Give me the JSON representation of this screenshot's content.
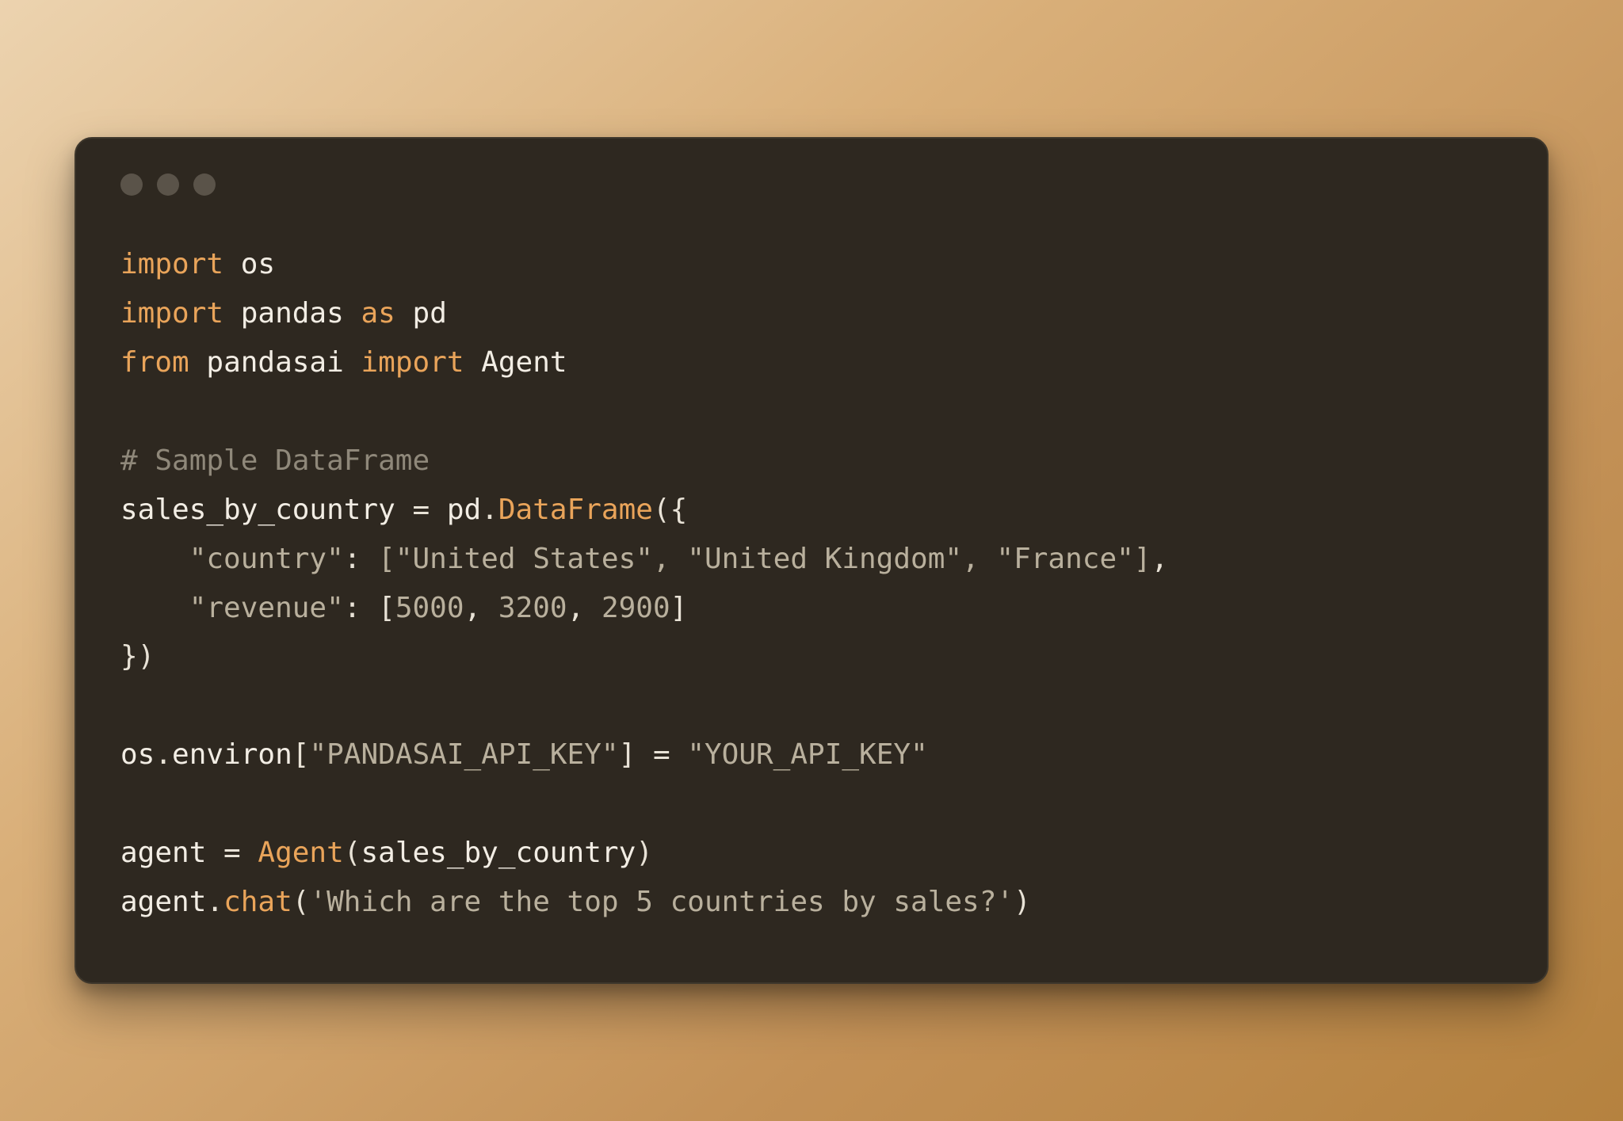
{
  "colors": {
    "bg_window": "#2e2820",
    "keyword": "#e9a45a",
    "identifier": "#f2ede4",
    "comment": "#8f887a",
    "string": "#b9b09d",
    "number": "#b9b09d",
    "func": "#e9a45a"
  },
  "code": {
    "l1": {
      "kw1": "import",
      "id1": "os"
    },
    "l2": {
      "kw1": "import",
      "id1": "pandas",
      "kw2": "as",
      "id2": "pd"
    },
    "l3": {
      "kw1": "from",
      "id1": "pandasai",
      "kw2": "import",
      "id2": "Agent"
    },
    "l4": "",
    "l5": {
      "cmt": "# Sample DataFrame"
    },
    "l6": {
      "id1": "sales_by_country",
      "op1": " = ",
      "id2": "pd",
      "dot": ".",
      "func1": "DataFrame",
      "open": "({"
    },
    "l7": {
      "indent": "    ",
      "key": "\"country\"",
      "colon": ": ",
      "val": "[\"United States\", \"United Kingdom\", \"France\"]",
      "comma": ","
    },
    "l8": {
      "indent": "    ",
      "key": "\"revenue\"",
      "colon": ": ",
      "open": "[",
      "n1": "5000",
      "c1": ", ",
      "n2": "3200",
      "c2": ", ",
      "n3": "2900",
      "close": "]"
    },
    "l9": {
      "close": "})"
    },
    "l10": "",
    "l11": {
      "id1": "os",
      "dot": ".",
      "id2": "environ",
      "open": "[",
      "key": "\"PANDASAI_API_KEY\"",
      "close": "]",
      "op1": " = ",
      "val": "\"YOUR_API_KEY\""
    },
    "l12": "",
    "l13": {
      "id1": "agent",
      "op1": " = ",
      "func1": "Agent",
      "open": "(",
      "arg": "sales_by_country",
      "close": ")"
    },
    "l14": {
      "id1": "agent",
      "dot": ".",
      "func1": "chat",
      "open": "(",
      "str": "'Which are the top 5 countries by sales?'",
      "close": ")"
    }
  }
}
